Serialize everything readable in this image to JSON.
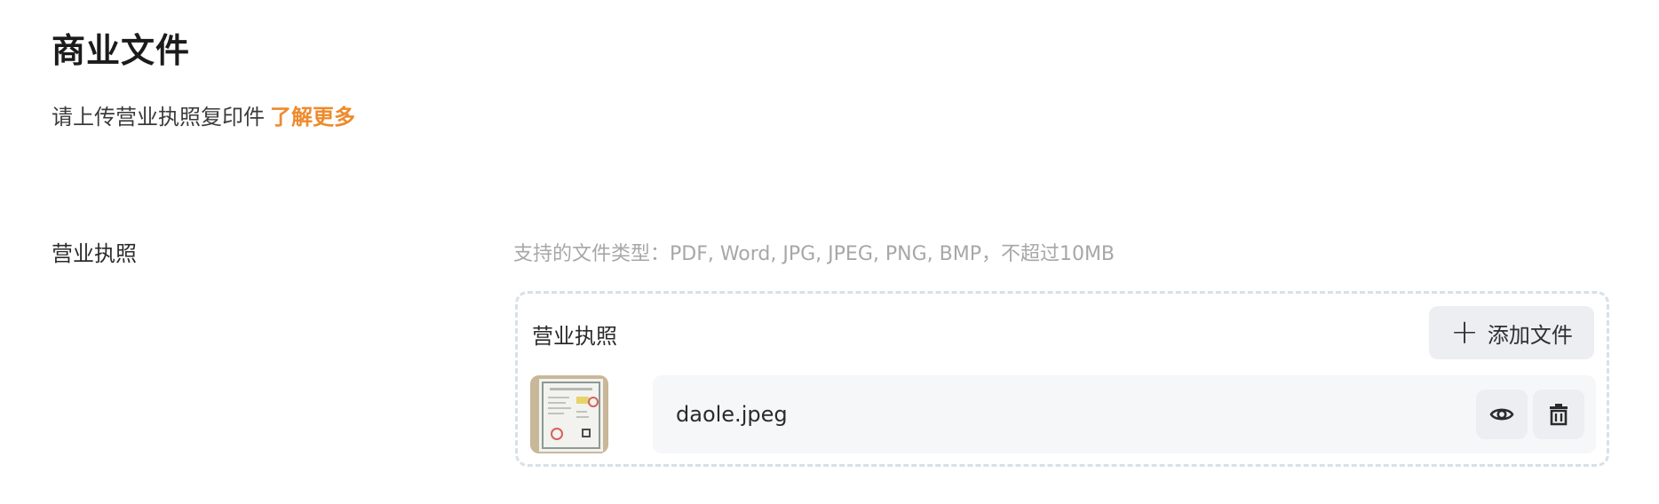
{
  "section": {
    "title": "商业文件",
    "subtitle": "请上传营业执照复印件",
    "learn_more": "了解更多"
  },
  "field": {
    "label": "营业执照",
    "hint": "支持的文件类型：PDF, Word, JPG, JPEG, PNG, BMP，不超过10MB"
  },
  "upload": {
    "title": "营业执照",
    "add_button_label": "添加文件",
    "file": {
      "name": "daole.jpeg"
    }
  },
  "colors": {
    "accent": "#ee8a2c",
    "dashed_border": "#d4e2ea",
    "button_bg": "#eceef1"
  }
}
